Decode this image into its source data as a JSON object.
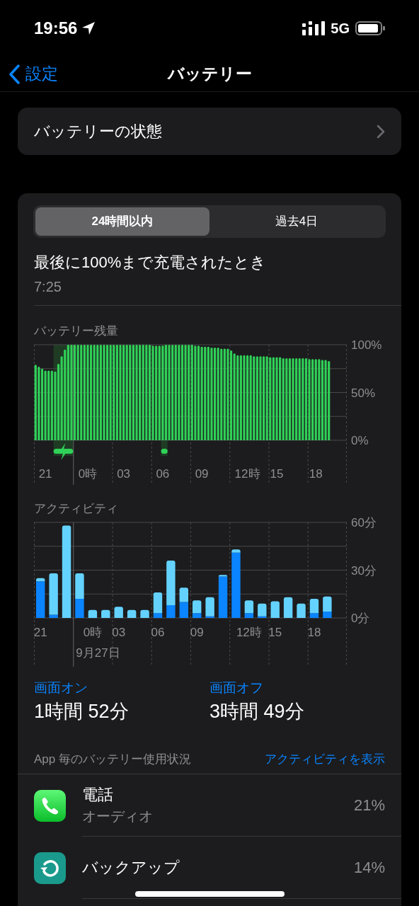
{
  "status_bar": {
    "time": "19:56",
    "network": "5G"
  },
  "nav": {
    "back": "設定",
    "title": "バッテリー"
  },
  "health_row": {
    "label": "バッテリーの状態"
  },
  "segments": [
    {
      "label": "24時間以内",
      "selected": true
    },
    {
      "label": "過去4日",
      "selected": false
    }
  ],
  "last_charge": {
    "label": "最後に100%まで充電されたとき",
    "time": "7:25"
  },
  "battery_level": {
    "chart_data": {
      "type": "bar",
      "title": "バッテリー残量",
      "categories": [
        null,
        null,
        null,
        "21",
        null,
        null,
        null,
        null,
        null,
        null,
        null,
        null,
        null,
        null,
        null,
        null,
        "0時",
        null,
        null,
        null,
        null,
        null,
        null,
        null,
        null,
        null,
        null,
        "03",
        null,
        null,
        null,
        null,
        null,
        null,
        null,
        null,
        null,
        null,
        null,
        "06",
        null,
        null,
        null,
        null,
        null,
        null,
        null,
        null,
        null,
        null,
        null,
        "09",
        null,
        null,
        null,
        null,
        null,
        null,
        null,
        null,
        null,
        null,
        null,
        null,
        null,
        "12時",
        null,
        null,
        null,
        null,
        null,
        null,
        null,
        null,
        "15",
        null,
        null,
        null,
        null,
        null,
        null,
        null,
        null,
        null,
        null,
        null,
        "18",
        null,
        null,
        null,
        null
      ],
      "values": [
        79,
        77,
        75,
        73,
        73,
        73,
        72,
        80,
        88,
        95,
        100,
        100,
        100,
        100,
        100,
        100,
        100,
        100,
        100,
        100,
        100,
        100,
        100,
        100,
        100,
        100,
        100,
        100,
        100,
        100,
        100,
        100,
        100,
        100,
        100,
        100,
        99,
        99,
        99,
        99,
        100,
        100,
        100,
        100,
        100,
        100,
        100,
        100,
        100,
        99,
        99,
        98,
        98,
        98,
        97,
        97,
        97,
        96,
        96,
        96,
        94,
        91,
        89,
        89,
        89,
        89,
        89,
        88,
        88,
        88,
        88,
        88,
        87,
        87,
        87,
        87,
        86,
        86,
        86,
        86,
        86,
        86,
        86,
        86,
        85,
        85,
        85,
        85,
        84,
        84,
        83
      ],
      "ylim": [
        0,
        100
      ],
      "yticks": [
        {
          "value": 0,
          "label": "0%"
        },
        {
          "value": 50,
          "label": "50%"
        },
        {
          "value": 100,
          "label": "100%"
        }
      ]
    }
  },
  "activity": {
    "date_label": "9月27日",
    "chart_data": {
      "type": "bar",
      "title": "アクティビティ",
      "stacked": true,
      "categories": [
        "21",
        null,
        null,
        null,
        "0時",
        null,
        "03",
        null,
        null,
        "06",
        null,
        null,
        "09",
        null,
        null,
        null,
        "12時",
        null,
        "15",
        null,
        null,
        "18",
        null
      ],
      "series": [
        {
          "color": "#0a84ff",
          "values": [
            23,
            2,
            0,
            12,
            0,
            0,
            0,
            0,
            0,
            3,
            8,
            10,
            3,
            1,
            26,
            41,
            3,
            1,
            0,
            0,
            0,
            3,
            4
          ]
        },
        {
          "color": "#64d2ff",
          "values": [
            2,
            26,
            58,
            16,
            5,
            5,
            7,
            5,
            5,
            13,
            28,
            9,
            8,
            12,
            1,
            2,
            8,
            8,
            10.5,
            13,
            9,
            9,
            9.5
          ]
        }
      ],
      "ylim": [
        0,
        60
      ],
      "yticks": [
        {
          "value": 0,
          "label": "0分"
        },
        {
          "value": 30,
          "label": "30分"
        },
        {
          "value": 60,
          "label": "60分"
        }
      ]
    }
  },
  "totals": [
    {
      "label": "画面オン",
      "value": "1時間 52分"
    },
    {
      "label": "画面オフ",
      "value": "3時間 49分"
    }
  ],
  "usage_header": {
    "title": "App 毎のバッテリー使用状況",
    "link": "アクティビティを表示"
  },
  "apps": [
    {
      "kind": "phone",
      "name": "電話",
      "detail": "オーディオ",
      "percent": "21%"
    },
    {
      "kind": "backup",
      "name": "バックアップ",
      "percent": "14%"
    }
  ]
}
